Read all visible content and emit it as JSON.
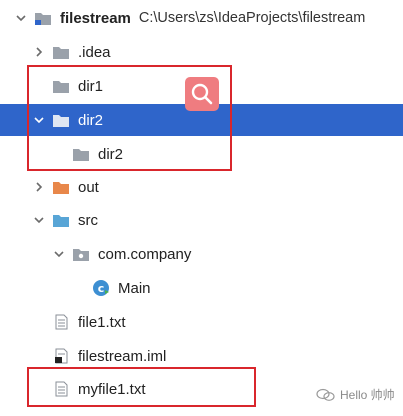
{
  "project": {
    "name": "filestream",
    "path": "C:\\Users\\zs\\IdeaProjects\\filestream"
  },
  "tree": [
    {
      "label": "filestream",
      "type": "module-root"
    },
    {
      "label": ".idea",
      "type": "folder",
      "expanded": false
    },
    {
      "label": "dir1",
      "type": "folder",
      "expanded": null
    },
    {
      "label": "dir2",
      "type": "folder",
      "expanded": true,
      "selected": true
    },
    {
      "label": "dir2",
      "type": "folder",
      "expanded": null
    },
    {
      "label": "out",
      "type": "folder-excluded",
      "expanded": false
    },
    {
      "label": "src",
      "type": "folder-source",
      "expanded": true
    },
    {
      "label": "com.company",
      "type": "package",
      "expanded": true
    },
    {
      "label": "Main",
      "type": "java-class"
    },
    {
      "label": "file1.txt",
      "type": "text-file"
    },
    {
      "label": "filestream.iml",
      "type": "iml-file"
    },
    {
      "label": "myfile1.txt",
      "type": "text-file"
    }
  ],
  "watermark": {
    "text": "Hello 帅帅"
  },
  "colors": {
    "selection": "#2f65ca",
    "highlight_box": "#d9262c",
    "folder": "#9aa1aa",
    "folder_excluded": "#e8874a",
    "folder_source": "#58a5d6",
    "java_class": "#3d8fd2"
  }
}
